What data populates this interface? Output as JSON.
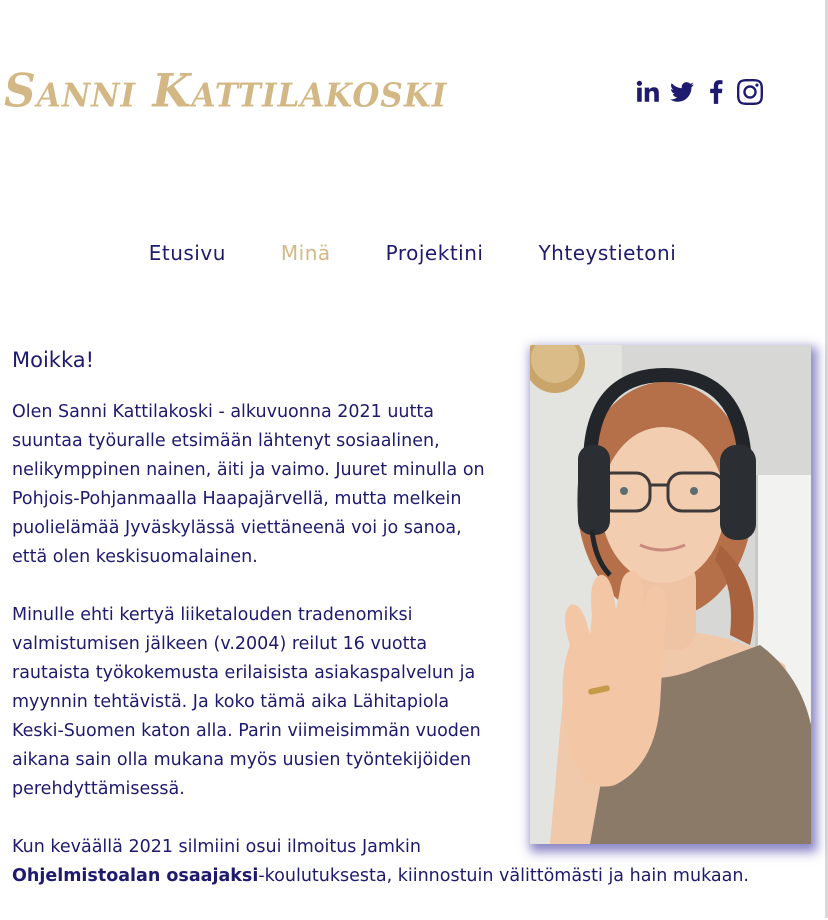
{
  "site": {
    "logo_text": "Sanni Kattilakoski"
  },
  "social": [
    {
      "name": "linkedin-icon"
    },
    {
      "name": "twitter-icon"
    },
    {
      "name": "facebook-icon"
    },
    {
      "name": "instagram-icon"
    }
  ],
  "nav": {
    "items": [
      {
        "label": "Etusivu",
        "active": false
      },
      {
        "label": "Minä",
        "active": true
      },
      {
        "label": "Projektini",
        "active": false
      },
      {
        "label": "Yhteystietoni",
        "active": false
      }
    ]
  },
  "main": {
    "heading": "Moikka!",
    "p1": "Olen Sanni Kattilakoski - alkuvuonna 2021 uutta suuntaa työuralle etsimään lähtenyt sosiaalinen, nelikymppinen nainen, äiti ja vaimo. Juuret minulla on Pohjois-Pohjanmaalla Haapajärvellä, mutta melkein puolielämää Jyväskylässä viettäneenä voi jo sanoa, että olen keskisuomalainen.",
    "p2": "Minulle ehti kertyä liiketalouden tradenomiksi valmistumisen jälkeen (v.2004) reilut 16 vuotta rautaista työkokemusta erilaisista asiakaspalvelun ja myynnin tehtävistä. Ja koko tämä aika Lähitapiola Keski-Suomen katon alla. Parin viimeisimmän vuoden aikana sain olla mukana myös uusien työntekijöiden perehdyttämisessä.",
    "p3_start": "Kun keväällä 2021 silmiini osui ilmoitus Jamkin",
    "p3_link": "Ohjelmistoalan osaajaksi",
    "p3_end": "-koulutuksesta, kiinnostuin välittömästi ja hain mukaan."
  }
}
